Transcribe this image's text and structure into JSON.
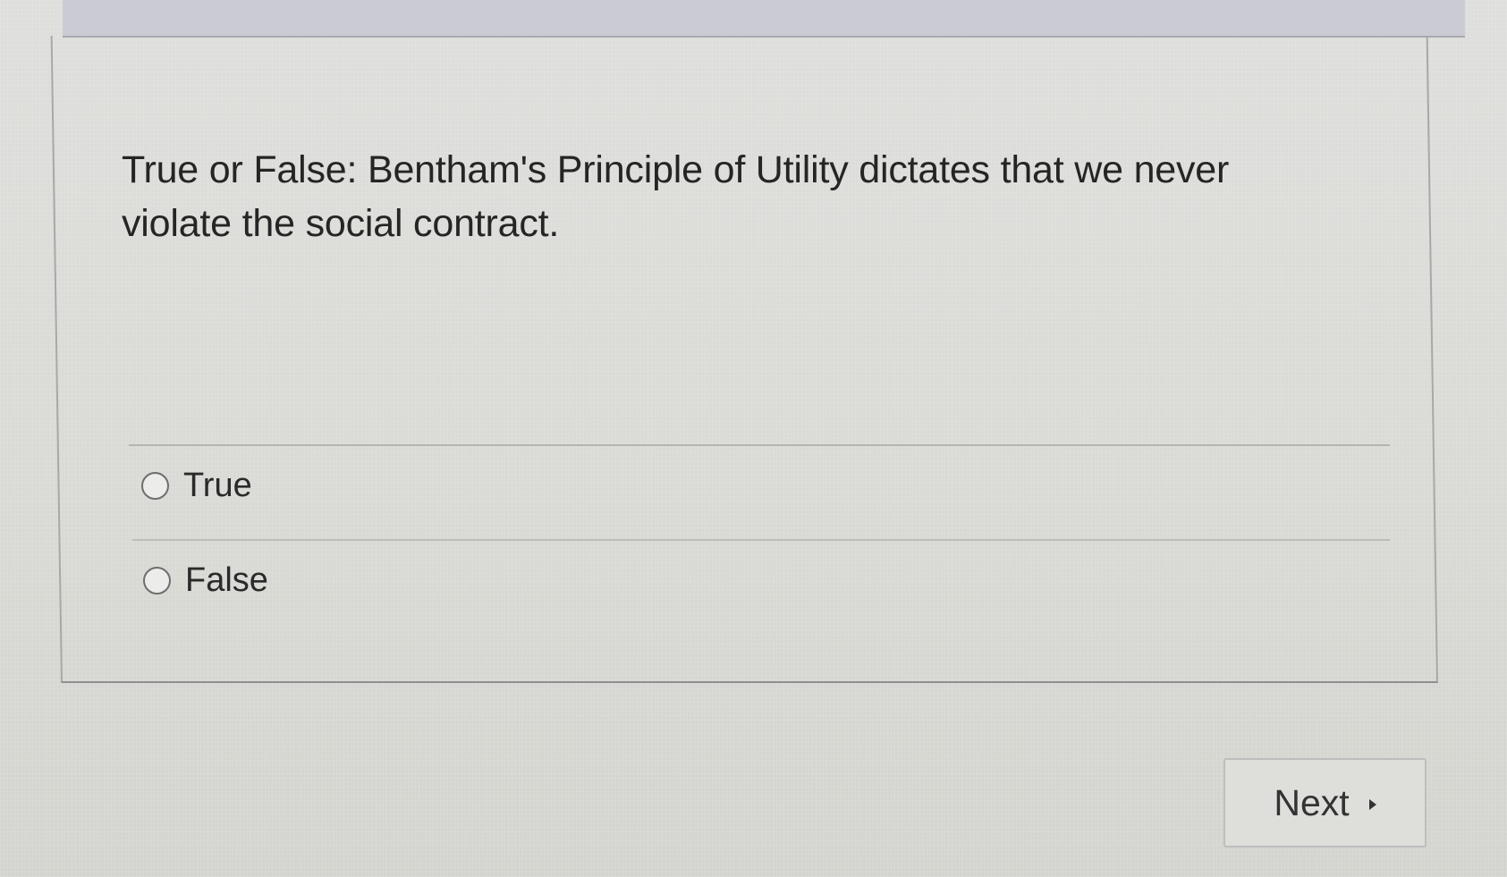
{
  "question": {
    "text": "True or False: Bentham's Principle of Utility dictates that we never violate the social contract."
  },
  "options": [
    {
      "label": "True",
      "selected": false
    },
    {
      "label": "False",
      "selected": false
    }
  ],
  "navigation": {
    "next_label": "Next",
    "next_icon": "play-arrow-icon"
  },
  "colors": {
    "background": "#dcdcd8",
    "header_bar": "#cbcbd3",
    "card_border": "#a8a8a8",
    "text": "#252525"
  }
}
